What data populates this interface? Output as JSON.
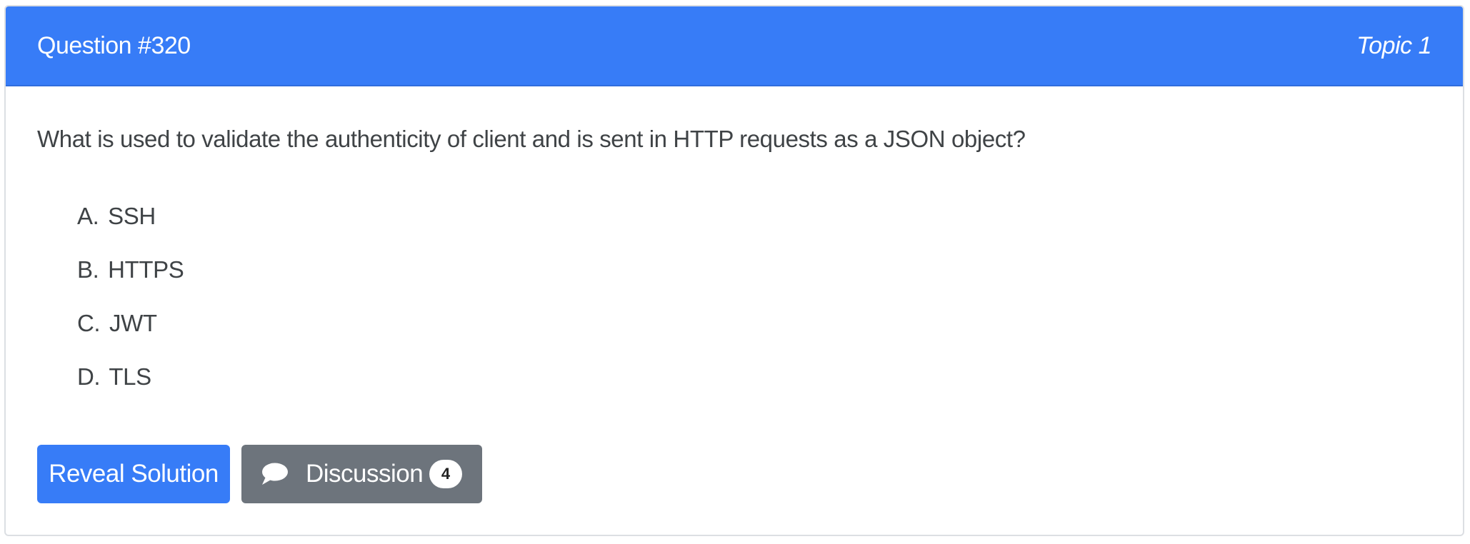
{
  "header": {
    "title": "Question #320",
    "topic": "Topic 1"
  },
  "question": {
    "text": "What is used to validate the authenticity of client and is sent in HTTP requests as a JSON object?"
  },
  "choices": [
    {
      "letter": "A.",
      "text": "SSH"
    },
    {
      "letter": "B.",
      "text": "HTTPS"
    },
    {
      "letter": "C.",
      "text": "JWT"
    },
    {
      "letter": "D.",
      "text": "TLS"
    }
  ],
  "actions": {
    "reveal_label": "Reveal Solution",
    "discussion_label": "Discussion",
    "discussion_count": "4",
    "discussion_icon": "speech-bubble-icon"
  },
  "colors": {
    "primary": "#377cf7",
    "secondary": "#6d747c"
  }
}
